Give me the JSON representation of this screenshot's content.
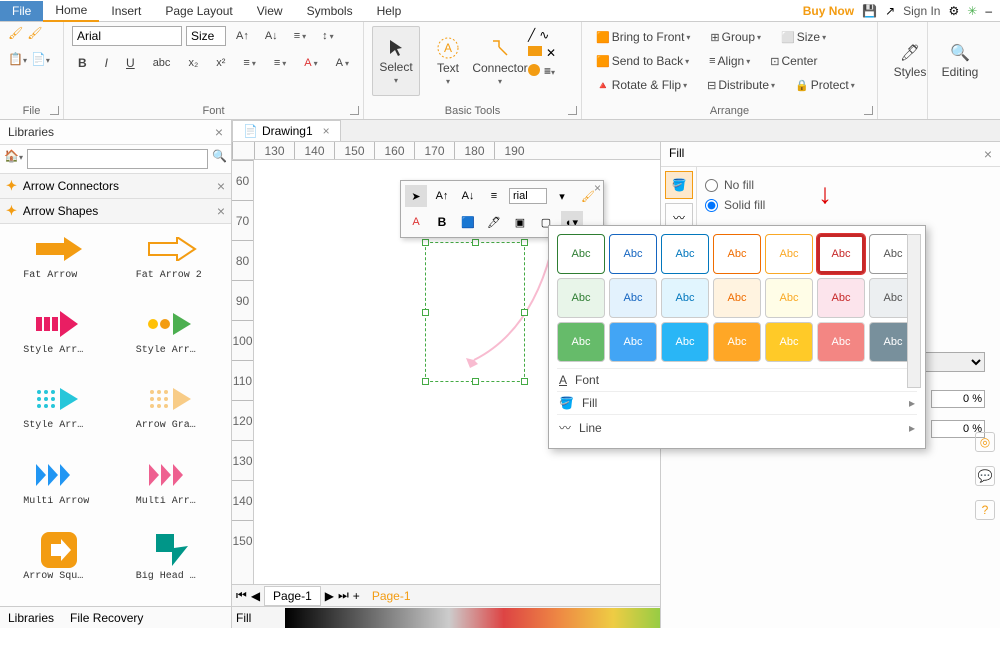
{
  "menu": {
    "file": "File",
    "home": "Home",
    "insert": "Insert",
    "pageLayout": "Page Layout",
    "view": "View",
    "symbols": "Symbols",
    "help": "Help",
    "buyNow": "Buy Now",
    "signIn": "Sign In"
  },
  "ribbon": {
    "fileGroup": "File",
    "fontGroup": "Font",
    "font": "Arial",
    "size": "Size",
    "basicTools": "Basic Tools",
    "select": "Select",
    "text": "Text",
    "connector": "Connector",
    "arrange": "Arrange",
    "bringFront": "Bring to Front",
    "sendBack": "Send to Back",
    "rotateFlip": "Rotate & Flip",
    "group": "Group",
    "align": "Align",
    "distribute": "Distribute",
    "center": "Center",
    "protect": "Protect",
    "styles": "Styles",
    "editing": "Editing"
  },
  "libraries": {
    "title": "Libraries",
    "arrowConnectors": "Arrow Connectors",
    "arrowShapes": "Arrow Shapes",
    "shapes": [
      {
        "name": "Fat Arrow"
      },
      {
        "name": "Fat Arrow 2"
      },
      {
        "name": "Style Arr…"
      },
      {
        "name": "Style Arr…"
      },
      {
        "name": "Style Arr…"
      },
      {
        "name": "Arrow Gra…"
      },
      {
        "name": "Multi Arrow"
      },
      {
        "name": "Multi Arr…"
      },
      {
        "name": "Arrow Squ…"
      },
      {
        "name": "Big Head …"
      }
    ],
    "tab1": "Libraries",
    "tab2": "File Recovery"
  },
  "doc": {
    "tab": "Drawing1",
    "rulerH": [
      "130",
      "140",
      "150",
      "160",
      "170",
      "180",
      "190"
    ],
    "rulerV": [
      "60",
      "70",
      "80",
      "90",
      "100",
      "110",
      "120",
      "130",
      "140",
      "150"
    ]
  },
  "pages": {
    "page": "Page-1",
    "page2": "Page-1",
    "fill": "Fill"
  },
  "fillPanel": {
    "title": "Fill",
    "noFill": "No fill",
    "solidFill": "Solid fill",
    "pct": "0 %"
  },
  "floatToolbar": {
    "font": "rial"
  },
  "stylePopup": {
    "abc": "Abc",
    "font": "Font",
    "fill": "Fill",
    "line": "Line"
  }
}
